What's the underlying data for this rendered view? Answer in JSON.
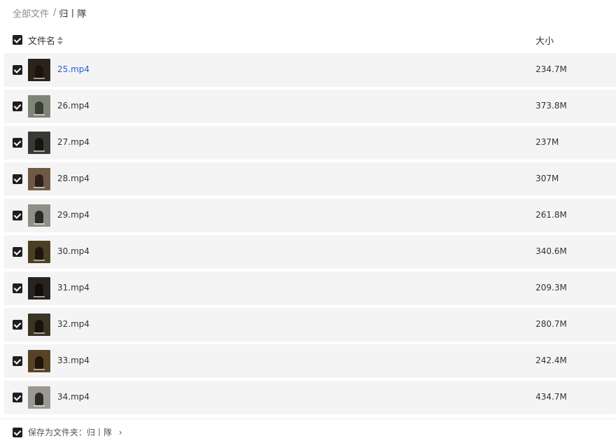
{
  "breadcrumb": {
    "root": "全部文件",
    "separator": "/",
    "current": "归丨隊"
  },
  "header": {
    "name_label": "文件名",
    "size_label": "大小",
    "sort_icon": "sort-updown-icon",
    "select_all_checked": true
  },
  "files": [
    {
      "name": "25.mp4",
      "size": "234.7M",
      "checked": true,
      "active": true,
      "thumb": {
        "bg": "#2b2219",
        "fig": "#1a130e"
      }
    },
    {
      "name": "26.mp4",
      "size": "373.8M",
      "checked": true,
      "active": false,
      "thumb": {
        "bg": "#7d8574",
        "fig": "#3a3c35"
      }
    },
    {
      "name": "27.mp4",
      "size": "237M",
      "checked": true,
      "active": false,
      "thumb": {
        "bg": "#3a3a34",
        "fig": "#151512"
      }
    },
    {
      "name": "28.mp4",
      "size": "307M",
      "checked": true,
      "active": false,
      "thumb": {
        "bg": "#6e5a44",
        "fig": "#2c2118"
      }
    },
    {
      "name": "29.mp4",
      "size": "261.8M",
      "checked": true,
      "active": false,
      "thumb": {
        "bg": "#8f8f86",
        "fig": "#2a2a26"
      }
    },
    {
      "name": "30.mp4",
      "size": "340.6M",
      "checked": true,
      "active": false,
      "thumb": {
        "bg": "#4a3f22",
        "fig": "#1c170b"
      }
    },
    {
      "name": "31.mp4",
      "size": "209.3M",
      "checked": true,
      "active": false,
      "thumb": {
        "bg": "#28231c",
        "fig": "#0f0c09"
      }
    },
    {
      "name": "32.mp4",
      "size": "280.7M",
      "checked": true,
      "active": false,
      "thumb": {
        "bg": "#3b3423",
        "fig": "#17130b"
      }
    },
    {
      "name": "33.mp4",
      "size": "242.4M",
      "checked": true,
      "active": false,
      "thumb": {
        "bg": "#5a4226",
        "fig": "#1e150c"
      }
    },
    {
      "name": "34.mp4",
      "size": "434.7M",
      "checked": true,
      "active": false,
      "thumb": {
        "bg": "#9a9890",
        "fig": "#2b2a26"
      }
    }
  ],
  "footer": {
    "label": "保存为文件夹：归丨隊",
    "chevron": "›",
    "checked": true
  },
  "colors": {
    "row_bg": "#f4f4f5",
    "checkbox": "#1f1f1f",
    "link_active": "#2a5bd7"
  }
}
